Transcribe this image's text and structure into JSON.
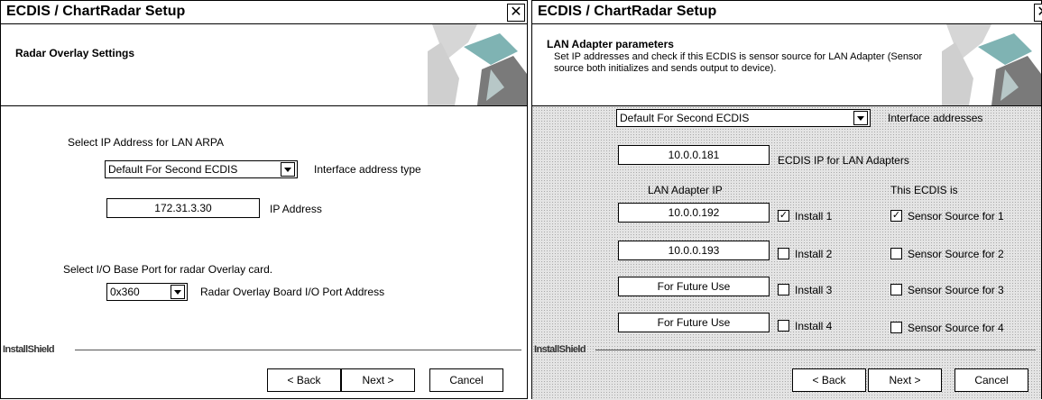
{
  "dialog1": {
    "title": "ECDIS / ChartRadar Setup",
    "header_title": "Radar Overlay Settings",
    "select_ip_label": "Select IP Address for LAN ARPA",
    "address_type_value": "Default For Second ECDIS",
    "address_type_label": "Interface address type",
    "ip_value": "172.31.3.30",
    "ip_label": "IP Address",
    "select_port_label": "Select I/O Base Port for radar Overlay card.",
    "port_value": "0x360",
    "port_label": "Radar Overlay Board I/O Port Address",
    "brand": "InstallShield",
    "buttons": {
      "back": "< Back",
      "next": "Next >",
      "cancel": "Cancel"
    }
  },
  "dialog2": {
    "title": "ECDIS / ChartRadar Setup",
    "header_title": "LAN Adapter parameters",
    "header_desc": "Set IP addresses and check if this ECDIS is sensor source for LAN Adapter (Sensor source both initializes and sends output to device).",
    "interface_value": "Default For Second ECDIS",
    "interface_label": "Interface addresses",
    "ecdis_ip_value": "10.0.0.181",
    "ecdis_ip_label": "ECDIS IP for LAN Adapters",
    "col_adapter_ip": "LAN Adapter IP",
    "col_this_ecdis": "This ECDIS is",
    "adapters": [
      {
        "ip": "10.0.0.192",
        "install_label": "Install 1",
        "install_checked": true,
        "sensor_label": "Sensor Source for 1",
        "sensor_checked": true
      },
      {
        "ip": "10.0.0.193",
        "install_label": "Install 2",
        "install_checked": false,
        "sensor_label": "Sensor Source for 2",
        "sensor_checked": false
      },
      {
        "ip": "For Future Use",
        "install_label": "Install 3",
        "install_checked": false,
        "sensor_label": "Sensor Source for 3",
        "sensor_checked": false
      },
      {
        "ip": "For Future Use",
        "install_label": "Install 4",
        "install_checked": false,
        "sensor_label": "Sensor Source for 4",
        "sensor_checked": false
      }
    ],
    "brand": "InstallShield",
    "buttons": {
      "back": "< Back",
      "next": "Next >",
      "cancel": "Cancel"
    }
  },
  "icons": {
    "close": "close-icon",
    "dropdown": "chevron-down-icon",
    "check": "checkmark-icon"
  }
}
